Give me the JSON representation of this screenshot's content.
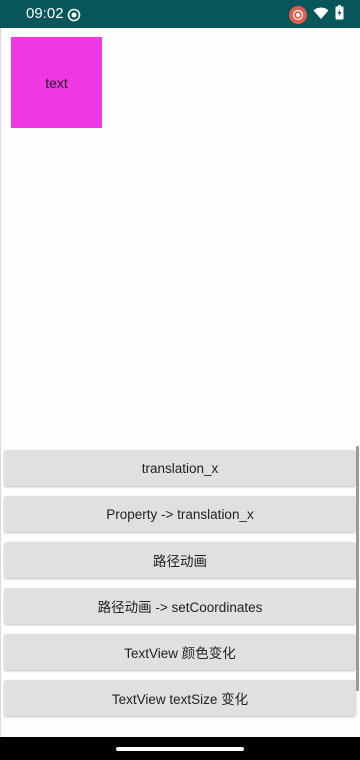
{
  "status_bar": {
    "time": "09:02",
    "icons": [
      "record-icon",
      "wifi-icon",
      "battery-icon"
    ]
  },
  "animated_box": {
    "label": "text",
    "color": "#ef37e4"
  },
  "buttons": [
    {
      "label": "translation_x"
    },
    {
      "label": "Property -> translation_x"
    },
    {
      "label": "路径动画"
    },
    {
      "label": "路径动画 -> setCoordinates"
    },
    {
      "label": "TextView 颜色变化"
    },
    {
      "label": "TextView textSize 变化"
    }
  ],
  "colors": {
    "status_bar": "#07565a",
    "button_bg": "#e0e0e0",
    "record_badge": "#e25b4d"
  }
}
